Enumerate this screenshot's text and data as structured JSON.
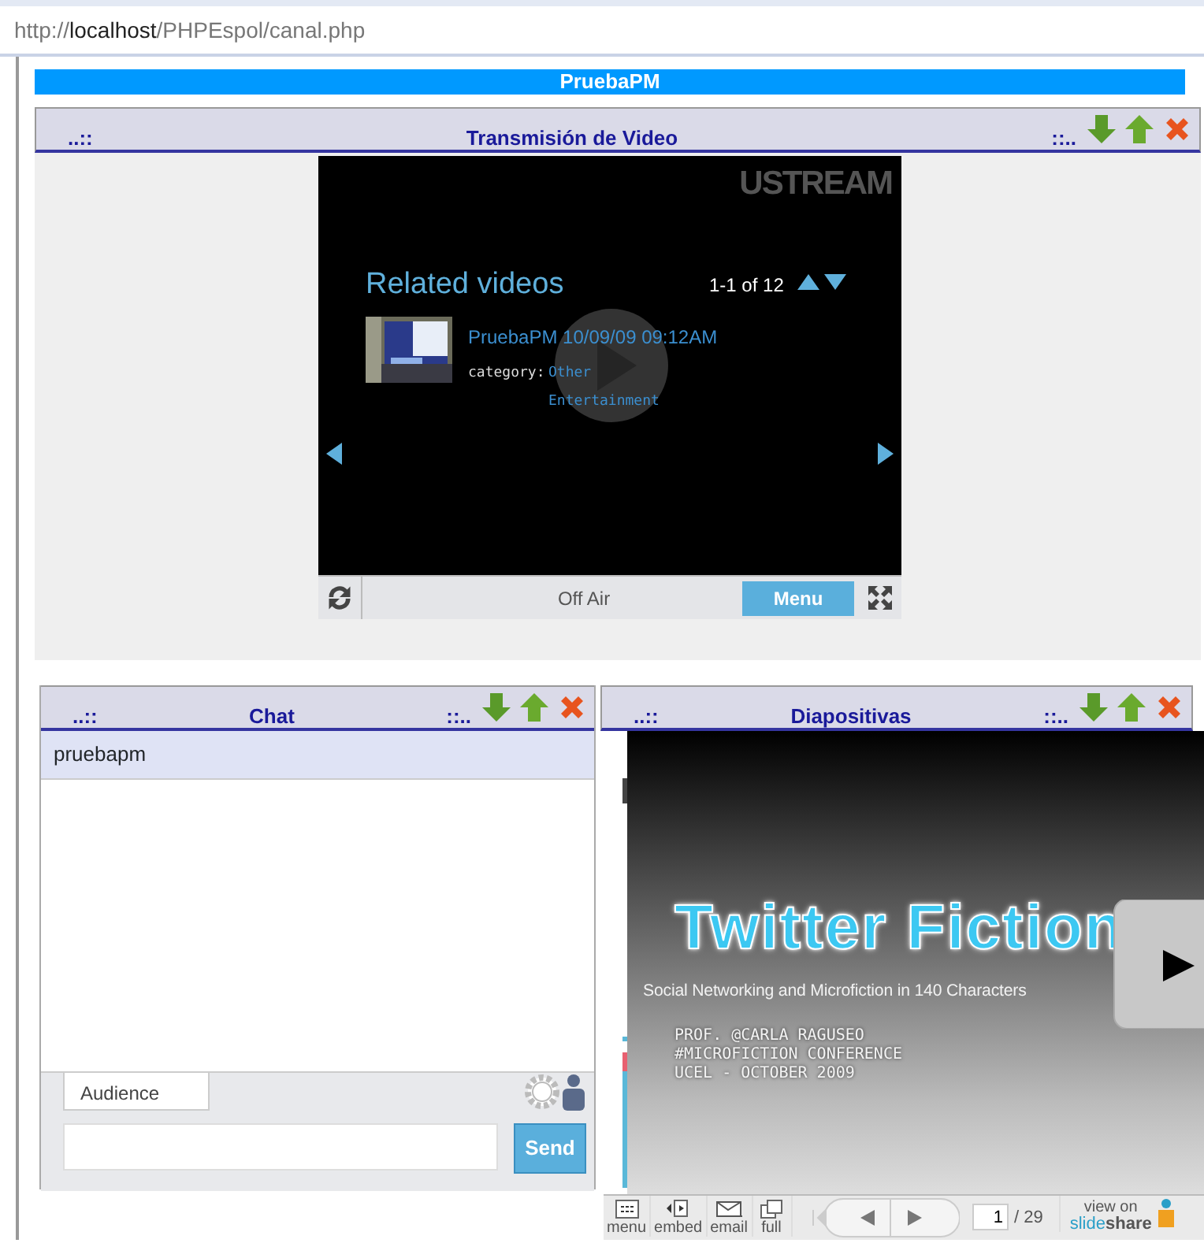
{
  "address_bar": {
    "url": "http://**localhost**/PHPEspol/canal.php"
  },
  "page_title": "PruebaPM",
  "panels": [
    {
      "kind": "video",
      "deco_left": "..::",
      "title": "Transmisión de Video",
      "deco_right": "::..",
      "player": {
        "brand": "USTREAM",
        "heading": "Related videos",
        "count": "1-1 of 12",
        "video_title": "PruebaPM 10/09/09 09:12AM",
        "category_label": "category:",
        "category_lines": [
          "Other",
          "Entertainment"
        ],
        "status": "Off Air",
        "menu_button": "Menu"
      }
    },
    {
      "kind": "chat",
      "deco_left": "..::",
      "title": "Chat",
      "deco_right": "::..",
      "users": [
        "pruebapm"
      ],
      "tabs": [
        {
          "label": "Audience",
          "selected": true
        }
      ],
      "send_button": "Send"
    },
    {
      "kind": "slides",
      "deco_left": "..::",
      "title": "Diapositivas",
      "deco_right": "::..",
      "slide": {
        "title": "Twitter Fiction",
        "subtitle": "Social Networking and Microfiction in 140 Characters",
        "lines": [
          "PROF. @CARLA RAGUSEO",
          "#MICROFICTION CONFERENCE",
          "UCEL - OCTOBER 2009"
        ]
      },
      "toolbar": {
        "tools": [
          "menu",
          "embed",
          "email",
          "full"
        ],
        "page": "1",
        "total": "/ 29",
        "view_on": "view on",
        "brand_parts": [
          "slide",
          "share"
        ]
      }
    }
  ]
}
